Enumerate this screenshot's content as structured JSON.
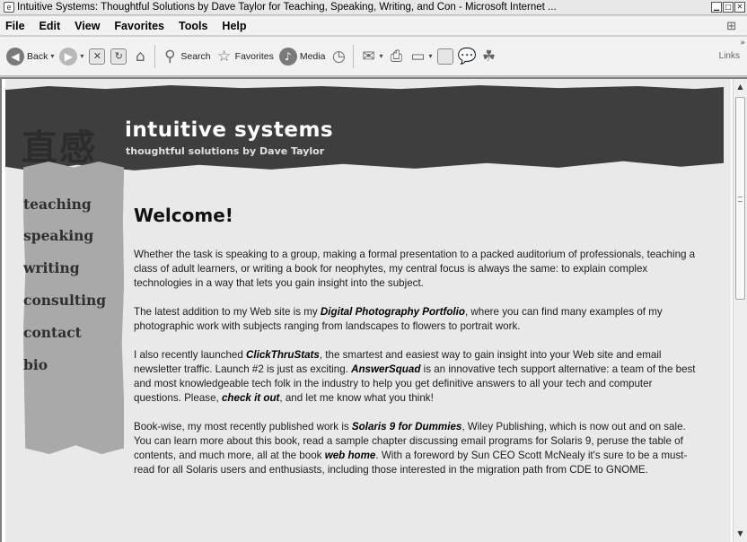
{
  "window": {
    "title": "Intuitive Systems: Thoughtful Solutions by Dave Taylor for Teaching, Speaking, Writing, and Con - Microsoft Internet ..."
  },
  "menu": [
    "File",
    "Edit",
    "View",
    "Favorites",
    "Tools",
    "Help"
  ],
  "toolbar": {
    "back": "Back",
    "search": "Search",
    "favorites": "Favorites",
    "media": "Media",
    "links": "Links"
  },
  "site": {
    "kanji": "直感",
    "title": "intuitive systems",
    "subtitle": "thoughtful solutions by Dave Taylor"
  },
  "nav": [
    "teaching",
    "speaking",
    "writing",
    "consulting",
    "contact",
    "bio"
  ],
  "main": {
    "heading": "Welcome!",
    "p1": "Whether the task is speaking to a group, making a formal presentation to a packed auditorium of professionals, teaching a class of adult learners, or writing a book for neophytes, my central focus is always the same: to explain complex technologies in a way that lets you gain insight into the subject.",
    "p2": [
      "The latest addition to my Web site is my ",
      "Digital Photography Portfolio",
      ", where you can find many examples of my photographic work with subjects ranging from landscapes to flowers to portrait work."
    ],
    "p3": [
      "I also recently launched ",
      "ClickThruStats",
      ", the smartest and easiest way to gain insight into your Web site and email newsletter traffic. Launch #2 is just as exciting. ",
      "AnswerSquad",
      " is an innovative tech support alternative: a team of the best and most knowledgeable tech folk in the industry to help you get definitive answers to all your tech and computer questions. Please, ",
      "check it out",
      ", and let me know what you think!"
    ],
    "p4": [
      "Book-wise, my most recently published work is ",
      "Solaris 9 for Dummies",
      ", Wiley Publishing, which is now out and on sale. You can learn more about this book, read a sample chapter discussing email programs for Solaris 9, peruse the table of contents, and much more, all at the book ",
      "web home",
      ". With a foreword by Sun CEO Scott McNealy it's sure to be a must-read for all Solaris users and enthusiasts, including those interested in the migration path from CDE to GNOME."
    ]
  }
}
